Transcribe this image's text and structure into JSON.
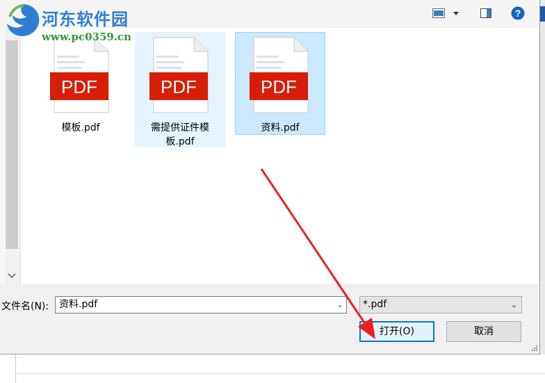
{
  "toolbar": {
    "view_icon": "view-icon",
    "preview_icon": "preview-pane-icon",
    "help_icon": "help-icon",
    "help_glyph": "?"
  },
  "watermark": {
    "title": "河东软件园",
    "url": "www.pc0359.cn"
  },
  "files": [
    {
      "name": "模板.pdf",
      "state": "normal",
      "badge": "PDF"
    },
    {
      "name": "需提供证件模板.pdf",
      "state": "hover",
      "badge": "PDF"
    },
    {
      "name": "资料.pdf",
      "state": "selected",
      "badge": "PDF"
    }
  ],
  "filename": {
    "label": "文件名(N):",
    "value": "资料.pdf"
  },
  "filter": {
    "value": "*.pdf"
  },
  "buttons": {
    "open": "打开(O)",
    "cancel": "取消"
  },
  "colors": {
    "pdf_red": "#d81e06",
    "accent": "#0078d7",
    "arrow": "#e8231e"
  }
}
